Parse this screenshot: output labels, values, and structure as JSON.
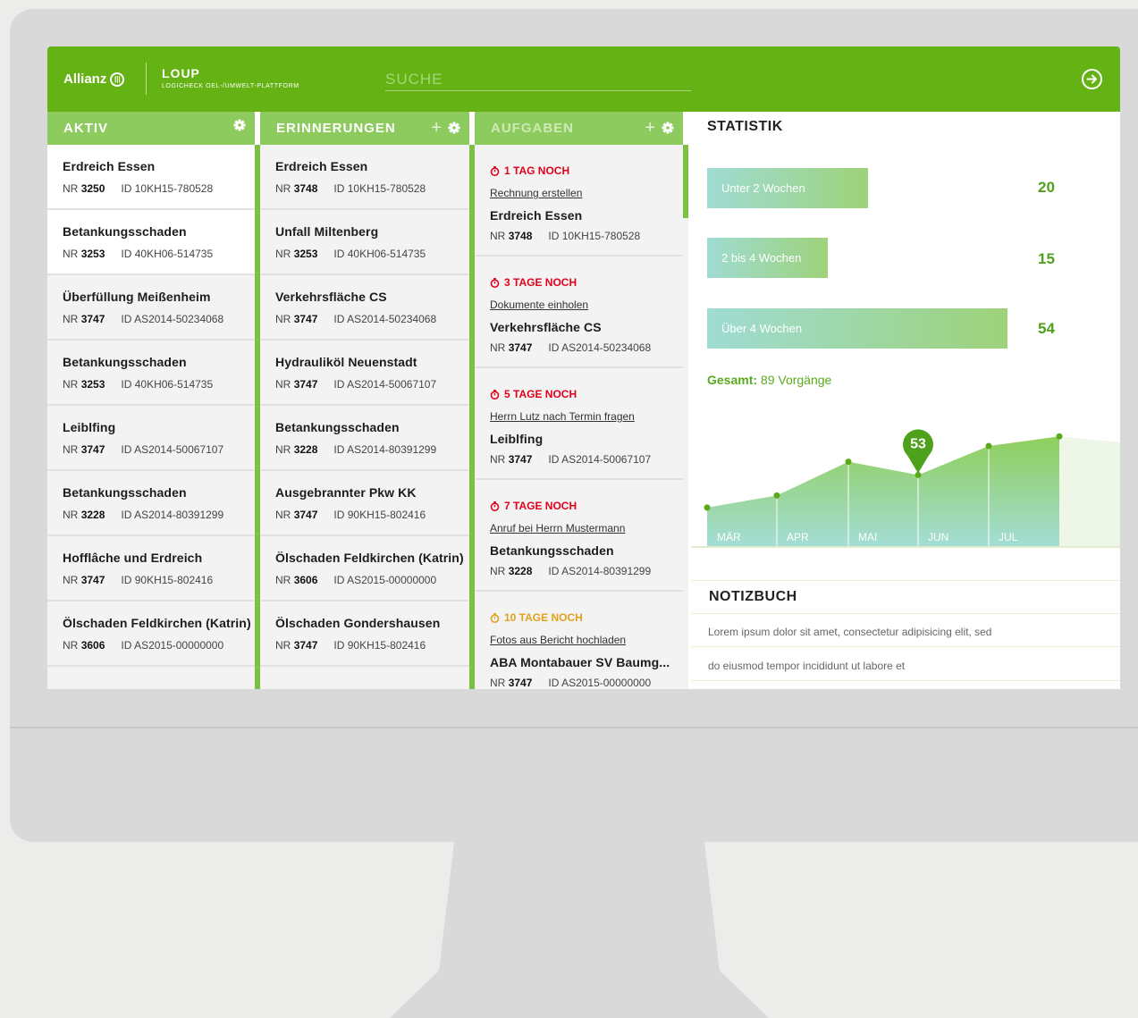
{
  "header": {
    "brand": "Allianz",
    "app_title": "LOUP",
    "app_subtitle": "LOGICHECK OEL-/UMWELT-PLATTFORM",
    "search_placeholder": "SUCHE"
  },
  "columns": {
    "aktiv": {
      "title": "AKTIV",
      "items": [
        {
          "title": "Erdreich Essen",
          "nr": "3250",
          "id": "10KH15-780528"
        },
        {
          "title": "Betankungsschaden",
          "nr": "3253",
          "id": "40KH06-514735"
        },
        {
          "title": "Überfüllung Meißenheim",
          "nr": "3747",
          "id": "AS2014-50234068"
        },
        {
          "title": "Betankungsschaden",
          "nr": "3253",
          "id": "40KH06-514735"
        },
        {
          "title": "Leiblfing",
          "nr": "3747",
          "id": "AS2014-50067107"
        },
        {
          "title": "Betankungsschaden",
          "nr": "3228",
          "id": "AS2014-80391299"
        },
        {
          "title": "Hofflâche und Erdreich",
          "nr": "3747",
          "id": "90KH15-802416"
        },
        {
          "title": "Ölschaden Feldkirchen (Katrin)",
          "nr": "3606",
          "id": "AS2015-00000000"
        }
      ]
    },
    "erinnerungen": {
      "title": "ERINNERUNGEN",
      "items": [
        {
          "title": "Erdreich Essen",
          "nr": "3748",
          "id": "10KH15-780528"
        },
        {
          "title": "Unfall Miltenberg",
          "nr": "3253",
          "id": "40KH06-514735"
        },
        {
          "title": "Verkehrsfläche CS",
          "nr": "3747",
          "id": "AS2014-50234068"
        },
        {
          "title": "Hydrauliköl Neuenstadt",
          "nr": "3747",
          "id": "AS2014-50067107"
        },
        {
          "title": "Betankungsschaden",
          "nr": "3228",
          "id": "AS2014-80391299"
        },
        {
          "title": "Ausgebrannter Pkw KK",
          "nr": "3747",
          "id": "90KH15-802416"
        },
        {
          "title": "Ölschaden Feldkirchen (Katrin)",
          "nr": "3606",
          "id": "AS2015-00000000"
        },
        {
          "title": "Ölschaden Gondershausen",
          "nr": "3747",
          "id": "90KH15-802416"
        }
      ]
    },
    "aufgaben": {
      "title": "AUFGABEN",
      "items": [
        {
          "due": "1 TAG NOCH",
          "task": "Rechnung erstellen",
          "title": "Erdreich Essen",
          "nr": "3748",
          "id": "10KH15-780528"
        },
        {
          "due": "3 TAGE NOCH",
          "task": "Dokumente einholen",
          "title": "Verkehrsfläche CS",
          "nr": "3747",
          "id": "AS2014-50234068"
        },
        {
          "due": "5 TAGE NOCH",
          "task": "Herrn Lutz nach Termin fragen",
          "title": "Leiblfing",
          "nr": "3747",
          "id": "AS2014-50067107"
        },
        {
          "due": "7 TAGE NOCH",
          "task": "Anruf bei Herrn Mustermann",
          "title": "Betankungsschaden",
          "nr": "3228",
          "id": "AS2014-80391299"
        },
        {
          "due": "10 TAGE NOCH",
          "task": "Fotos aus Bericht hochladen",
          "title": "ABA Montabauer SV Baumg...",
          "nr": "3747",
          "id": "AS2015-00000000"
        }
      ]
    }
  },
  "labels": {
    "nr": "NR",
    "id": "ID"
  },
  "statistik": {
    "title": "STATISTIK",
    "bars": [
      {
        "label": "Unter 2 Wochen",
        "value": "20"
      },
      {
        "label": "2 bis 4 Wochen",
        "value": "15"
      },
      {
        "label": "Über 4 Wochen",
        "value": "54"
      }
    ],
    "gesamt_label": "Gesamt:",
    "gesamt_value": "89 Vorgänge"
  },
  "chart_data": {
    "type": "area",
    "categories": [
      "MÄR",
      "APR",
      "MAI",
      "JUN",
      "JUL"
    ],
    "values": [
      26,
      36,
      64,
      53,
      77,
      85
    ],
    "highlight_label": "53",
    "colors": {
      "fill_top": "#8fcf5b",
      "fill_bottom": "#a4ddd5",
      "point": "#58aa1a"
    }
  },
  "notizbuch": {
    "title": "NOTIZBUCH",
    "lines": [
      "Lorem ipsum dolor sit amet, consectetur adipisicing elit, sed",
      "do eiusmod tempor incididunt ut labore et"
    ]
  }
}
